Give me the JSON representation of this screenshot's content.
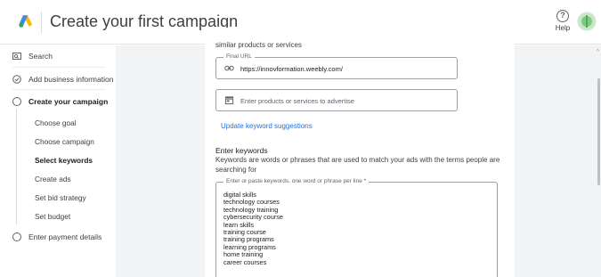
{
  "header": {
    "title": "Create your first campaign",
    "help_label": "Help"
  },
  "sidebar": {
    "search": "Search",
    "add_business": "Add business information",
    "create_campaign": "Create your campaign",
    "steps": [
      "Choose goal",
      "Choose campaign",
      "Select keywords",
      "Create ads",
      "Set bid strategy",
      "Set budget"
    ],
    "payment": "Enter payment details"
  },
  "main": {
    "intro_text": "similar products or services",
    "final_url": {
      "legend": "Final URL",
      "value": "https://innovformation.weebly.com/"
    },
    "products_placeholder": "Enter products or services to advertise",
    "update_link": "Update keyword suggestions",
    "keywords_title": "Enter keywords",
    "keywords_desc": "Keywords are words or phrases that are used to match your ads with the terms people are searching for",
    "keywords_field_legend": "Enter or paste keywords, one word or phrase per line *",
    "keywords": [
      "digital skills",
      "technology courses",
      "technology training",
      "cybersecurity course",
      "learn skills",
      "training course",
      "training programs",
      "learning programs",
      "home training",
      "career courses"
    ]
  },
  "colors": {
    "accent": "#1a73e8",
    "background": "#f1f3f4"
  }
}
